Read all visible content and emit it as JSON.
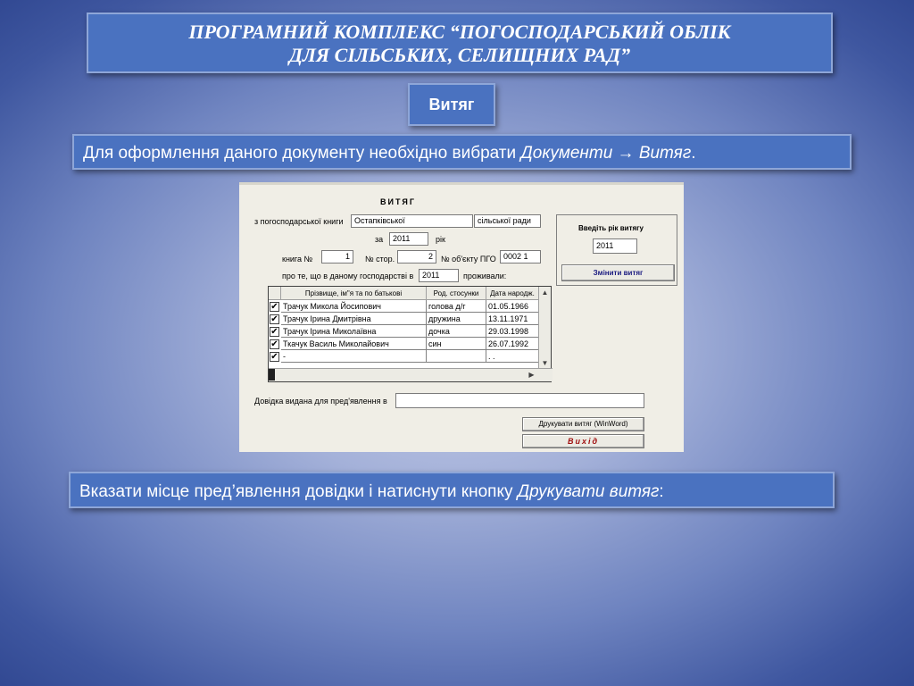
{
  "slide": {
    "title_line1": "ПРОГРАМНИЙ КОМПЛЕКС “ПОГОСПОДАРСЬКИЙ ОБЛІК",
    "title_line2": "ДЛЯ СІЛЬСЬКИХ, СЕЛИЩНИХ РАД”",
    "section_button": "Витяг",
    "instruction1_prefix": "Для оформлення даного документу необхідно вибрати ",
    "instruction1_italic": "Документи → Витяг",
    "instruction1_suffix": ".",
    "instruction2_prefix": "Вказати місце пред’явлення довідки і натиснути кнопку ",
    "instruction2_italic": "Друкувати витяг",
    "instruction2_suffix": ":"
  },
  "form": {
    "heading": "ВИТЯГ",
    "book_label": "з погосподарської книги",
    "book_value": "Остапківської",
    "council_value": "сільської ради",
    "for_label": "за",
    "year_value": "2011",
    "year_suffix": "рік",
    "book_no_label": "книга №",
    "book_no_value": "1",
    "page_label": "№ стор.",
    "page_value": "2",
    "object_label": "№ об'єкту ПГО",
    "object_value": "0002  1",
    "about_label": "про те, що в даному господарстві в",
    "about_year": "2011",
    "lived_label": "проживали:",
    "year_panel_label": "Введіть рік витягу",
    "year_panel_value": "2011",
    "change_button": "Змінити витяг",
    "columns": [
      "Прізвище, ім\"я  та по батькові",
      "Род. стосунки",
      "Дата народж."
    ],
    "rows": [
      {
        "checked": "✔",
        "name": "Трачук Микола Йосипович",
        "relation": "голова д/г",
        "date": "01.05.1966"
      },
      {
        "checked": "✔",
        "name": "Трачук Ірина Дмитрівна",
        "relation": "дружина",
        "date": "13.11.1971"
      },
      {
        "checked": "✔",
        "name": "Трачук Ірина Миколаївна",
        "relation": "дочка",
        "date": "29.03.1998"
      },
      {
        "checked": "✔",
        "name": "Ткачук Василь Миколайович",
        "relation": "син",
        "date": "26.07.1992"
      },
      {
        "checked": "✔",
        "name": "-",
        "relation": "",
        "date": ". ."
      }
    ],
    "certificate_label": "Довідка видана для пред'явлення в",
    "certificate_value": "",
    "print_button": "Друкувати витяг (WinWord)",
    "exit_button": "Вихід"
  }
}
